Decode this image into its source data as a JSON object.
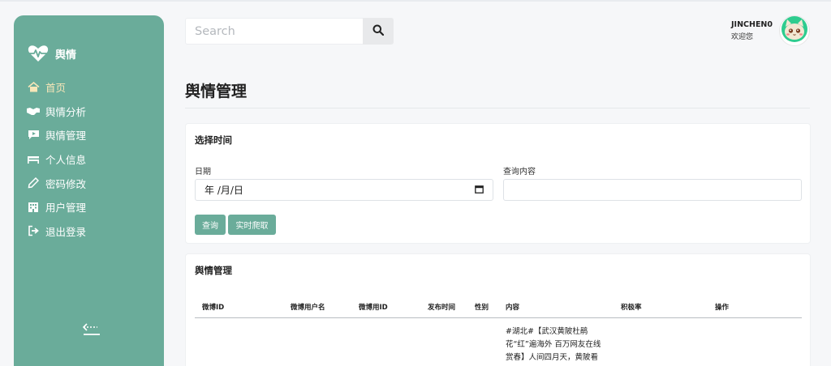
{
  "brand": {
    "title": "舆情"
  },
  "sidebar": {
    "items": [
      {
        "label": "首页",
        "icon": "home-icon",
        "active": true
      },
      {
        "label": "舆情分析",
        "icon": "handshake-icon",
        "active": false
      },
      {
        "label": "舆情管理",
        "icon": "video-comment-icon",
        "active": false
      },
      {
        "label": "个人信息",
        "icon": "bed-icon",
        "active": false
      },
      {
        "label": "密码修改",
        "icon": "pencil-icon",
        "active": false
      },
      {
        "label": "用户管理",
        "icon": "building-icon",
        "active": false
      },
      {
        "label": "退出登录",
        "icon": "logout-icon",
        "active": false
      }
    ],
    "collapse_icon": "collapse-arrow-icon"
  },
  "search": {
    "placeholder": "Search",
    "value": "",
    "icon": "search-icon"
  },
  "user": {
    "name": "JINCHEN0",
    "welcome": "欢迎您",
    "avatar_icon": "cat-avatar-icon"
  },
  "page": {
    "title": "舆情管理"
  },
  "filter": {
    "title": "选择时间",
    "date_label": "日期",
    "date_value": "年 /月/日",
    "query_label": "查询内容",
    "query_value": "",
    "query_button": "查询",
    "crawl_button": "实时爬取"
  },
  "table": {
    "title": "舆情管理",
    "columns": [
      "微博ID",
      "微博用户名",
      "微博用ID",
      "发布时间",
      "性别",
      "内容",
      "积极率",
      "操作"
    ],
    "rows": [
      {
        "content": "#湖北#【武汉黄陂杜鹃花“红”遍海外 百万网友在线赏春】人间四月天，黄陂看"
      }
    ]
  },
  "colors": {
    "accent": "#6aac9a",
    "active_nav": "#f7e6b8",
    "background": "#f6f7f9"
  }
}
